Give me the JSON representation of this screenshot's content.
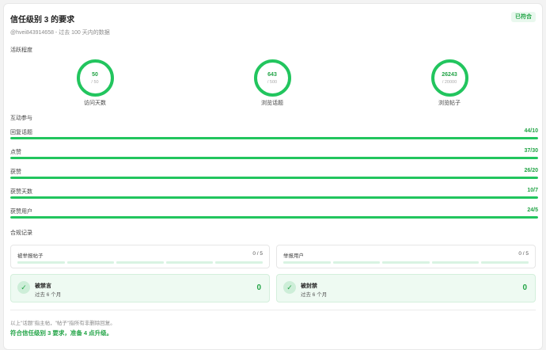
{
  "header": {
    "title": "信任级别 3 的要求",
    "status": "已符合",
    "subtitle": "@hvei843914658 - 过去 100 天内的数据"
  },
  "activity": {
    "section_label": "活跃程度",
    "circles": [
      {
        "value": "50",
        "required": "/ 50",
        "label": "访问天数"
      },
      {
        "value": "643",
        "required": "/ 500",
        "label": "浏览话题"
      },
      {
        "value": "26243",
        "required": "/ 20000",
        "label": "浏览帖子"
      }
    ]
  },
  "engagement": {
    "section_label": "互动参与",
    "rows": [
      {
        "label": "回复话题",
        "value": "44/10",
        "progress": 1.0
      },
      {
        "label": "点赞",
        "value": "37/30",
        "progress": 1.0
      },
      {
        "label": "获赞",
        "value": "26/20",
        "progress": 1.0
      },
      {
        "label": "获赞天数",
        "value": "10/7",
        "progress": 1.0
      },
      {
        "label": "获赞用户",
        "value": "24/5",
        "progress": 1.0
      }
    ]
  },
  "compliance": {
    "section_label": "合规记录",
    "flagged_posts": {
      "label": "被举报帖子",
      "value": "0 / 5"
    },
    "flagged_users": {
      "label": "举报用户",
      "value": "0 / 5"
    },
    "silenced": {
      "title": "被禁言",
      "subtitle": "过去 6 个月",
      "value": "0"
    },
    "suspended": {
      "title": "被封禁",
      "subtitle": "过去 6 个月",
      "value": "0"
    }
  },
  "footer": {
    "note": "以上\"话题\"指主帖，\"帖子\"指所有非删除回复。",
    "status_text": "符合信任级别 3 要求，准备 4 点升级。"
  },
  "colors": {
    "accent": "#22c55e",
    "accent_text": "#22a446",
    "track": "#d9f3e2"
  }
}
